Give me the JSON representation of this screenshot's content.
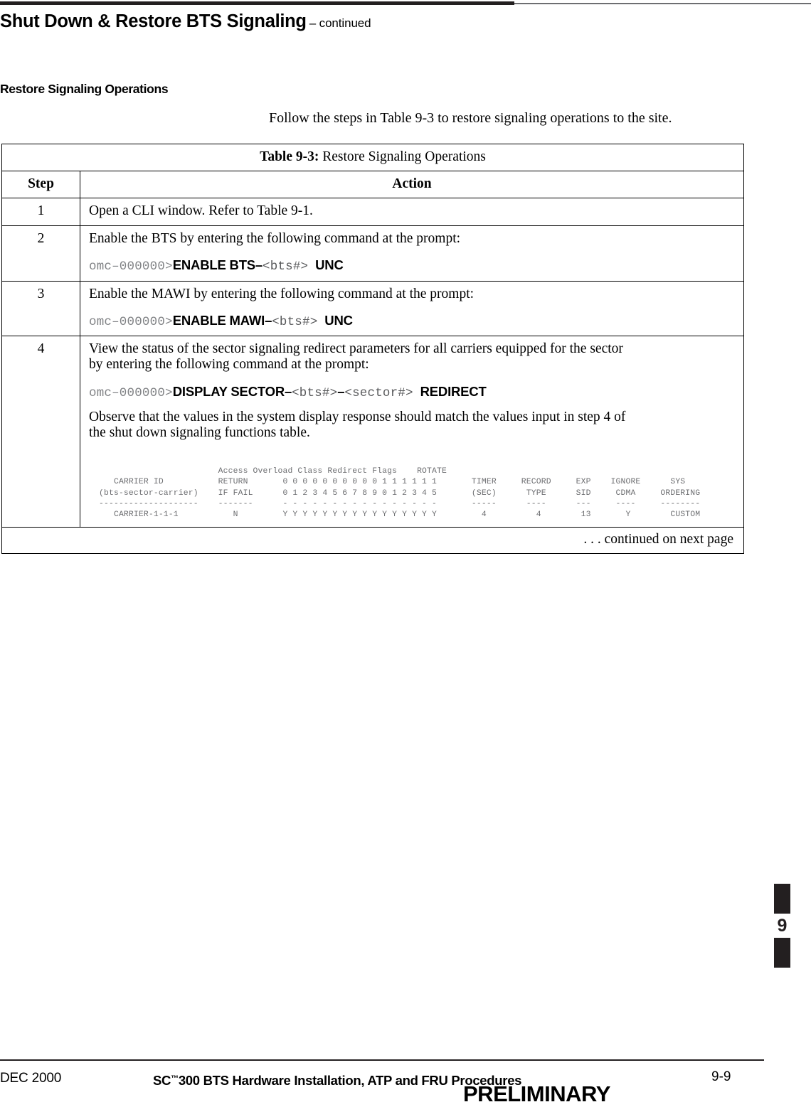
{
  "header": {
    "running_head_main": "Shut Down & Restore BTS Signaling",
    "running_head_continued": "– continued"
  },
  "section": {
    "heading": "Restore Signaling Operations",
    "intro": "Follow the steps in Table 9-3 to restore signaling operations to the site."
  },
  "table": {
    "caption_label": "Table 9-3:",
    "caption_text": " Restore Signaling Operations",
    "col_step": "Step",
    "col_action": "Action",
    "continued_note": ". . . continued on next page",
    "rows": [
      {
        "step": "1",
        "text": "Open a CLI window.  Refer to Table 9-1."
      },
      {
        "step": "2",
        "text": "Enable the BTS by entering the following command at the prompt:",
        "command": {
          "prompt": "omc–000000>",
          "cmd": "ENABLE BTS–",
          "var1": "<bts#>",
          "tail": "UNC"
        }
      },
      {
        "step": "3",
        "text": "Enable the MAWI by entering the following command at the prompt:",
        "command": {
          "prompt": "omc–000000>",
          "cmd": "ENABLE MAWI–",
          "var1": "<bts#>",
          "tail": "UNC"
        }
      },
      {
        "step": "4",
        "text_line1": "View the status of the sector signaling redirect parameters for all carriers equipped for the sector",
        "text_line2": "by entering the following command at the prompt:",
        "command": {
          "prompt": "omc–000000>",
          "cmd": "DISPLAY SECTOR–",
          "var1": "<bts#>",
          "dash": "–",
          "var2": "<sector#>",
          "tail": "REDIRECT"
        },
        "observe_line1": "Observe that the values in the system display response should match the values input in step 4 of",
        "observe_line2": "the shut down signaling functions table."
      }
    ]
  },
  "cli_output": {
    "lines": [
      "                        Access Overload Class Redirect Flags    ROTATE",
      "   CARRIER ID           RETURN       0 0 0 0 0 0 0 0 0 0 1 1 1 1 1 1       TIMER     RECORD     EXP    IGNORE      SYS",
      "(bts-sector-carrier)    IF FAIL      0 1 2 3 4 5 6 7 8 9 0 1 2 3 4 5       (SEC)      TYPE      SID     CDMA     ORDERING",
      "--------------------    -------      - - - - - - - - - - - - - - - -       -----      ----      ---     ----     --------",
      "   CARRIER-1-1-1           N         Y Y Y Y Y Y Y Y Y Y Y Y Y Y Y Y         4          4        13       Y        CUSTOM"
    ],
    "fields": {
      "carrier_id_header": "CARRIER ID",
      "carrier_id_sub": "(bts-sector-carrier)",
      "return_if_fail": "RETURN IF FAIL",
      "access_overload_title": "Access Overload Class Redirect Flags",
      "rotate_timer": "ROTATE TIMER (SEC)",
      "record_type": "RECORD TYPE",
      "exp_sid": "EXP SID",
      "ignore_cdma": "IGNORE CDMA",
      "sys_ordering": "SYS ORDERING",
      "row": {
        "carrier_id": "CARRIER-1-1-1",
        "return_if_fail": "N",
        "aoc_flags": [
          "Y",
          "Y",
          "Y",
          "Y",
          "Y",
          "Y",
          "Y",
          "Y",
          "Y",
          "Y",
          "Y",
          "Y",
          "Y",
          "Y",
          "Y",
          "Y"
        ],
        "rotate_timer_sec": "4",
        "record_type": "4",
        "exp_sid": "13",
        "ignore_cdma": "Y",
        "sys_ordering": "CUSTOM"
      }
    }
  },
  "chapter_tab": {
    "number": "9"
  },
  "footer": {
    "date": "DEC 2000",
    "title_prefix": "SC",
    "title_tm": "™",
    "title_rest": "300 BTS Hardware Installation, ATP and FRU Procedures",
    "page": "9-9",
    "watermark": "PRELIMINARY"
  }
}
